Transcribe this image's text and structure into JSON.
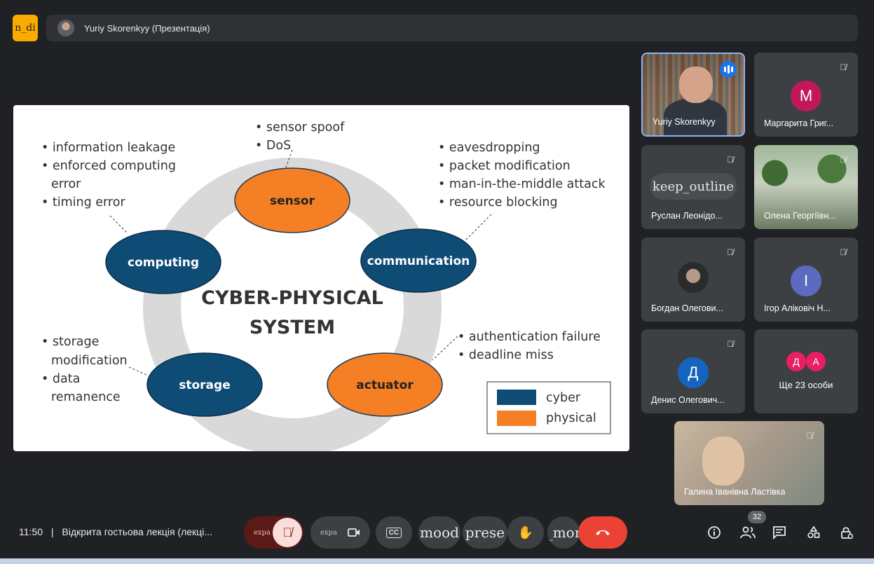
{
  "app_badge": "n_di",
  "header": {
    "presenter": "Yuriy Skorenkyy (Презентація)"
  },
  "slide": {
    "center_title": [
      "CYBER-PHYSICAL",
      "SYSTEM"
    ],
    "nodes": {
      "sensor": "sensor",
      "communication": "communication",
      "actuator": "actuator",
      "storage": "storage",
      "computing": "computing"
    },
    "bullets": {
      "sensor": [
        "• sensor spoof",
        "• DoS"
      ],
      "computing": [
        "• information leakage",
        "• enforced computing",
        "error",
        "• timing error"
      ],
      "communication": [
        "• eavesdropping",
        "• packet modification",
        "• man-in-the-middle attack",
        "• resource blocking"
      ],
      "actuator": [
        "• authentication failure",
        "• deadline miss"
      ],
      "storage": [
        "• storage",
        "modification",
        "• data",
        "remanence"
      ]
    },
    "legend": {
      "cyber": "cyber",
      "physical": "physical"
    },
    "colors": {
      "cyber": "#0f4c75",
      "physical": "#f47f24",
      "ring": "#d9d9d9"
    }
  },
  "participants": [
    {
      "name": "Yuriy Skorenkyy"
    },
    {
      "name": "Маргарита Григ...",
      "initial": "М",
      "color": "#c2185b"
    },
    {
      "name": "Руслан Леонідо...",
      "overlay": "keep_outline"
    },
    {
      "name": "Олена Георгіївн..."
    },
    {
      "name": "Богдан Олегови..."
    },
    {
      "name": "Ігор Аліковіч Н...",
      "initial": "І",
      "color": "#5c6bc0"
    },
    {
      "name": "Денис Олегович...",
      "initial": "Д",
      "color": "#1565c0"
    },
    {
      "name": "Ще 23 особи",
      "initials": [
        "Д",
        "А"
      ],
      "color": "#e91e63"
    },
    {
      "name": "Галина Іванівна Ластівка"
    }
  ],
  "footer": {
    "time": "11:50",
    "separator": "|",
    "meeting_title": "Відкрита гостьова лекція (лекці...",
    "mic_label": "expa",
    "cam_label": "expa",
    "cc_label": "CC",
    "mood_label": "mood",
    "present_label": "prese",
    "more_label": "_mor",
    "people_count": "32"
  },
  "icons": [
    "mic-off-icon",
    "camera-icon",
    "captions-icon",
    "hand-icon",
    "end-call-icon",
    "info-icon",
    "people-icon",
    "chat-icon",
    "activities-icon",
    "lock-icon"
  ]
}
